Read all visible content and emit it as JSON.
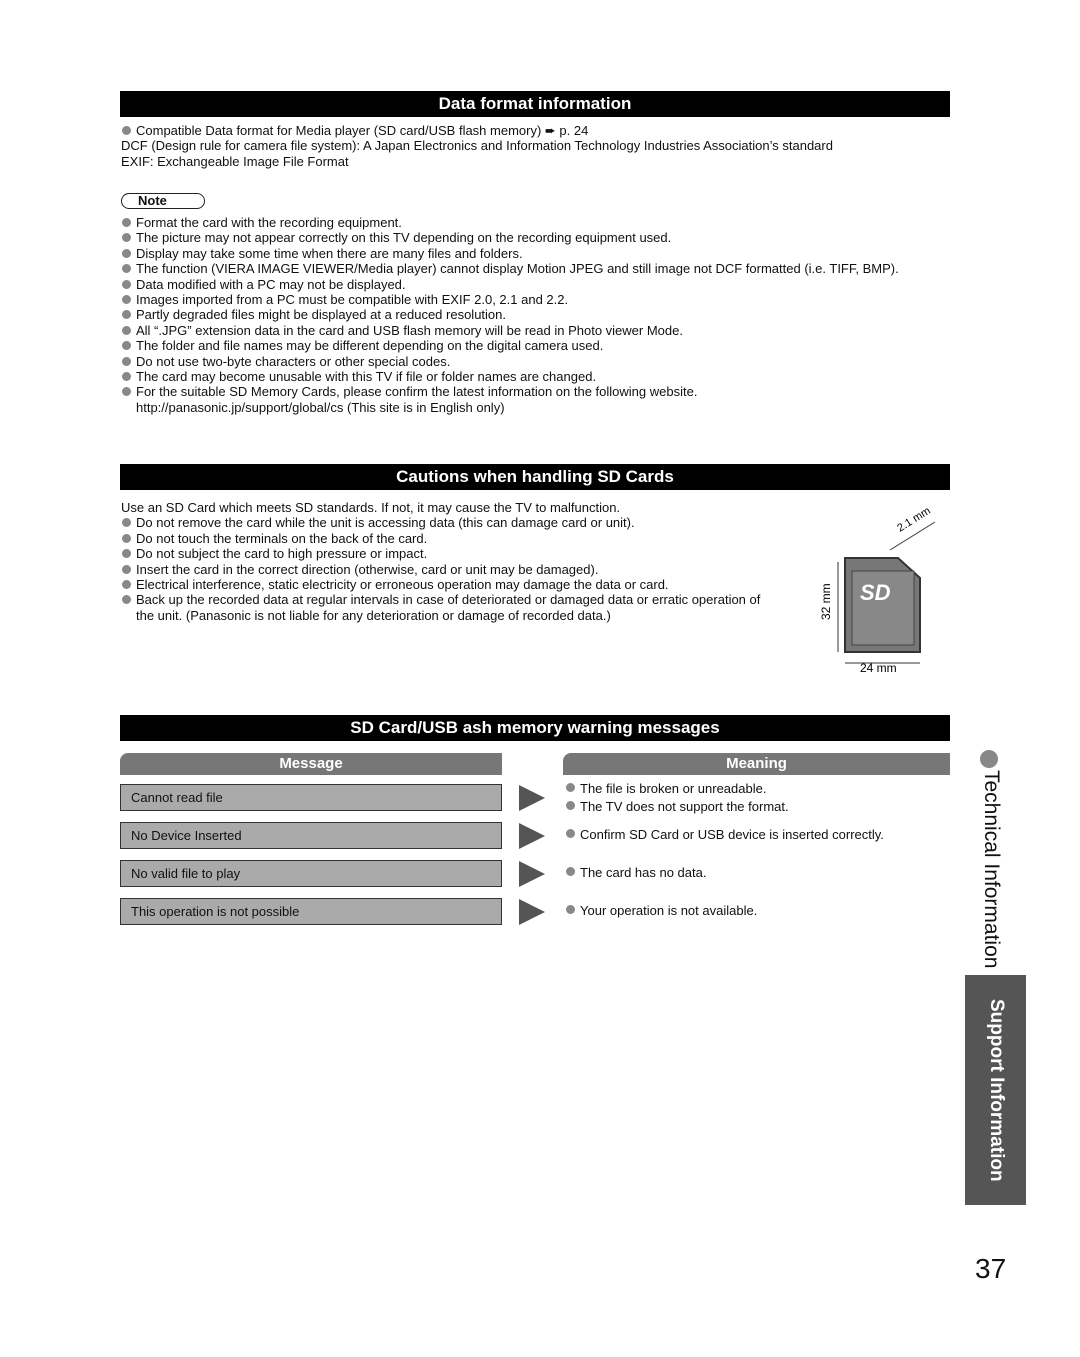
{
  "data_format": {
    "title": "Data format information",
    "intro_bullet": "Compatible Data format for Media player (SD card/USB flash memory) ➨ p. 24",
    "lines": [
      "DCF (Design rule for camera file system): A Japan Electronics and Information Technology Industries Association’s standard",
      "EXIF: Exchangeable Image File Format"
    ],
    "note_label": "Note",
    "notes": [
      "Format the card with the recording equipment.",
      "The picture may not appear correctly on this TV depending on the recording equipment used.",
      "Display may take some time when there are many files and folders.",
      "The function (VIERA IMAGE VIEWER/Media player) cannot display Motion JPEG and still image not DCF formatted (i.e. TIFF, BMP).",
      "Data modified with a PC may not be displayed.",
      "Images imported from a PC must be compatible with EXIF 2.0, 2.1 and 2.2.",
      "Partly degraded files might be displayed at a reduced resolution.",
      "All “.JPG” extension data in the card and USB flash memory will be read in Photo viewer Mode.",
      "The folder and file names may be different depending on the digital camera used.",
      "Do not use two-byte characters or other special codes.",
      "The card may become unusable with this TV if file or folder names are changed.",
      "For the suitable SD Memory Cards, please confirm the latest information on the following website."
    ],
    "website": "http://panasonic.jp/support/global/cs (This site is in English only)"
  },
  "cautions": {
    "title": "Cautions when handling SD Cards",
    "intro": "Use an SD Card which meets SD standards. If not, it may cause the TV to malfunction.",
    "bullets": [
      "Do not remove the card while the unit is accessing data (this can damage card or unit).",
      "Do not touch the terminals on the back of the card.",
      "Do not subject the card to high pressure or impact.",
      "Insert the card in the correct direction (otherwise, card or unit may be damaged).",
      "Electrical interference, static electricity or erroneous operation may damage the data or card.",
      "Back up the recorded data at regular intervals in case of deteriorated or damaged data or erratic operation of the unit. (Panasonic is not liable for any deterioration or damage of recorded data.)"
    ],
    "diagram": {
      "thickness": "2.1 mm",
      "height": "32 mm",
      "width": "24 mm",
      "logo": "SD"
    }
  },
  "warnings": {
    "title": "SD Card/USB   ash memory warning messages",
    "col_message": "Message",
    "col_meaning": "Meaning",
    "rows": [
      {
        "message": "Cannot read file",
        "meanings": [
          "The file is broken or unreadable.",
          "The TV does not support the format."
        ]
      },
      {
        "message": "No Device Inserted",
        "meanings": [
          "Confirm SD Card or USB device is inserted correctly."
        ]
      },
      {
        "message": "No valid file to play",
        "meanings": [
          "The card has no data."
        ]
      },
      {
        "message": "This operation is not possible",
        "meanings": [
          "Your operation is not available."
        ]
      }
    ]
  },
  "side": {
    "section": "Technical Information",
    "tab": "Support Information"
  },
  "page_number": "37"
}
